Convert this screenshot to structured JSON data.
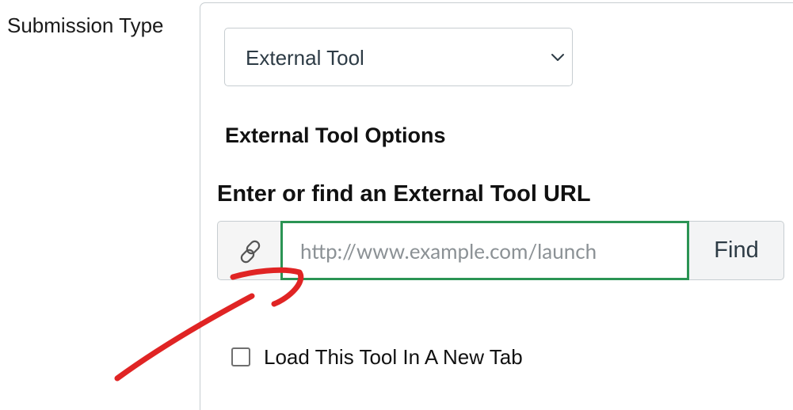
{
  "form": {
    "submission_type_label": "Submission Type",
    "submission_type": {
      "selected": "External Tool",
      "dropdown_icon": "chevron-down-icon"
    }
  },
  "external_tool": {
    "options_heading": "External Tool Options",
    "url_heading": "Enter or find an External Tool URL",
    "url_input": {
      "value": "",
      "placeholder": "http://www.example.com/launch",
      "addon_icon": "link-icon"
    },
    "find_button_label": "Find",
    "new_tab_checkbox": {
      "label": "Load This Tool In A New Tab",
      "checked": false
    }
  },
  "annotation": {
    "type": "red-arrow-drawing",
    "color": "#e02424"
  },
  "colors": {
    "input_focus_border": "#2b9454",
    "border": "#c7cdd1",
    "addon_background": "#f5f5f5"
  }
}
